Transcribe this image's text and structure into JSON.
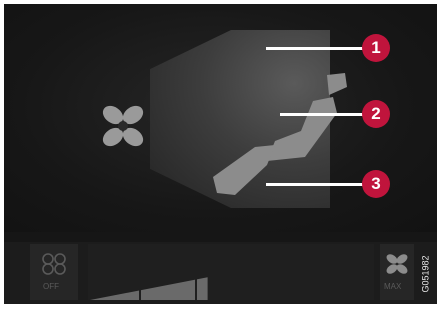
{
  "callouts": [
    {
      "number": "1"
    },
    {
      "number": "2"
    },
    {
      "number": "3"
    }
  ],
  "bottom_bar": {
    "off_label": "OFF",
    "max_label": "MAX",
    "fan_level": 0.6
  },
  "image_code": "G051982",
  "colors": {
    "callout": "#c0143c",
    "background": "#161616",
    "icon": "#9a9a9a"
  },
  "icons": [
    "fan-icon",
    "seat-icon",
    "off-fan-icon",
    "max-fan-icon"
  ]
}
